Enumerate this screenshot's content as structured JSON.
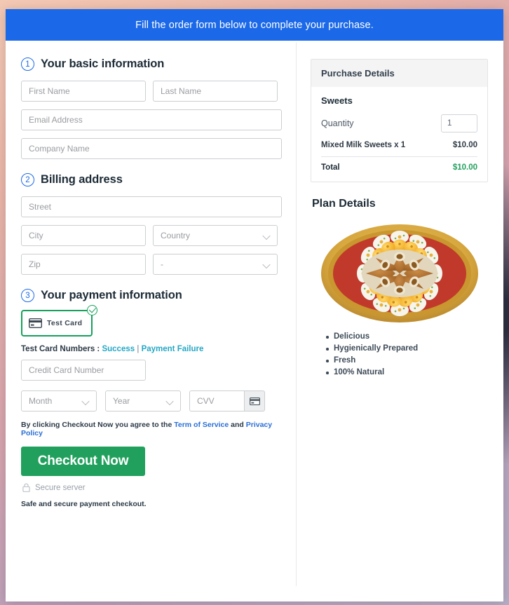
{
  "banner": {
    "text": "Fill the order form below to complete your purchase."
  },
  "sections": [
    {
      "num": "1",
      "title": "Your basic information"
    },
    {
      "num": "2",
      "title": "Billing address"
    },
    {
      "num": "3",
      "title": "Your payment information"
    }
  ],
  "basic_info": {
    "first_name_placeholder": "First Name",
    "last_name_placeholder": "Last Name",
    "email_placeholder": "Email Address",
    "company_placeholder": "Company Name"
  },
  "billing": {
    "street_placeholder": "Street",
    "city_placeholder": "City",
    "country_placeholder": "Country",
    "zip_placeholder": "Zip",
    "state_placeholder": "-"
  },
  "payment": {
    "tile_label": "Test  Card",
    "card_icon": "credit-card-icon",
    "check_icon": "check-circle-icon",
    "test_numbers_label": "Test Card Numbers :",
    "success_link": "Success",
    "separator": "|",
    "failure_link": "Payment Failure",
    "card_number_placeholder": "Credit Card Number",
    "month_placeholder": "Month",
    "year_placeholder": "Year",
    "cvv_placeholder": "CVV",
    "cvv_icon": "credit-card-icon"
  },
  "footer": {
    "terms_prefix": "By clicking Checkout Now you agree to the",
    "terms_link": "Term of Service",
    "terms_and": "and",
    "privacy_link": "Privacy Policy",
    "checkout_label": "Checkout Now",
    "lock_icon": "lock-icon",
    "secure_text": "Secure server",
    "safe_text": "Safe and secure payment checkout."
  },
  "purchase": {
    "panel_title": "Purchase Details",
    "product_name": "Sweets",
    "quantity_label": "Quantity",
    "quantity_value": "1",
    "line_item_label": "Mixed Milk Sweets x 1",
    "line_item_price": "$10.00",
    "total_label": "Total",
    "total_price": "$10.00"
  },
  "plan": {
    "title": "Plan Details",
    "image_alt": "sweets-platter-image",
    "features": [
      "Delicious",
      "Hygienically Prepared",
      "Fresh",
      "100% Natural"
    ]
  },
  "colors": {
    "banner_blue": "#1b69e8",
    "accent_green": "#21a05d",
    "tile_green": "#16a05c",
    "link_teal": "#25a7c4",
    "link_blue": "#2a6fd6"
  }
}
